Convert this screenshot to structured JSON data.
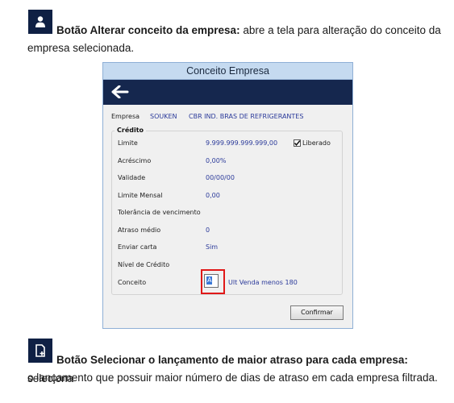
{
  "section1": {
    "icon": "user-icon",
    "title": "Botão Alterar conceito da empresa:",
    "text_line1": " abre a tela para alteração do conceito da",
    "text_line2": "empresa selecionada."
  },
  "dialog": {
    "title": "Conceito Empresa",
    "back_icon": "back-arrow-icon",
    "company_label": "Empresa",
    "company_code": "SOUKEN",
    "company_name": "CBR IND. BRAS DE REFRIGERANTES",
    "group_title": "Crédito",
    "fields": [
      {
        "label": "Limite",
        "value": "9.999.999.999.999,00"
      },
      {
        "label": "Acréscimo",
        "value": "0,00%"
      },
      {
        "label": "Validade",
        "value": "00/00/00"
      },
      {
        "label": "Limite Mensal",
        "value": "0,00"
      },
      {
        "label": "Tolerância de vencimento",
        "value": ""
      },
      {
        "label": "Atraso médio",
        "value": "0"
      },
      {
        "label": "Enviar carta",
        "value": "Sim"
      },
      {
        "label": "Nível de Crédito",
        "value": ""
      },
      {
        "label": "Conceito",
        "value": ""
      }
    ],
    "liberado_label": "Liberado",
    "liberado_checked": true,
    "conceito_code": "A",
    "conceito_desc": "Ult Venda menos 180",
    "confirm_label": "Confirmar",
    "highlight_color": "#e01818"
  },
  "section2": {
    "icon": "add-document-icon",
    "title": "Botão Selecionar o lançamento de maior atraso para cada empresa:",
    "text_line1": " seleciona",
    "text_line2": "o lançamento que possuir maior número de dias de atraso em cada empresa filtrada."
  }
}
